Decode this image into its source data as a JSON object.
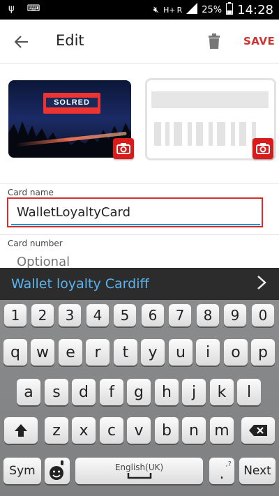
{
  "status_bar": {
    "network_type": "H+",
    "network_extra": "R",
    "battery_percent": "25%",
    "time": "14:28"
  },
  "app_bar": {
    "title": "Edit",
    "save_label": "SAVE",
    "accent_color": "#d32f2f"
  },
  "card_front": {
    "logo_text": "SOLRED"
  },
  "form": {
    "card_name_label": "Card name",
    "card_name_value": "WalletLoyaltyCard",
    "card_number_label": "Card number",
    "card_number_placeholder": "Optional"
  },
  "suggestion": {
    "text": "Wallet loyalty Cardiff"
  },
  "keyboard": {
    "number_row": [
      "1",
      "2",
      "3",
      "4",
      "5",
      "6",
      "7",
      "8",
      "9",
      "0"
    ],
    "row1": [
      "q",
      "w",
      "e",
      "r",
      "t",
      "y",
      "u",
      "i",
      "o",
      "p"
    ],
    "row2": [
      "a",
      "s",
      "d",
      "f",
      "g",
      "h",
      "j",
      "k",
      "l"
    ],
    "row3": [
      "z",
      "x",
      "c",
      "v",
      "b",
      "n",
      "m"
    ],
    "sym_label": "Sym",
    "space_label": "English(UK)",
    "period_label": ".",
    "period_alt": ",?",
    "next_label": "Next"
  }
}
